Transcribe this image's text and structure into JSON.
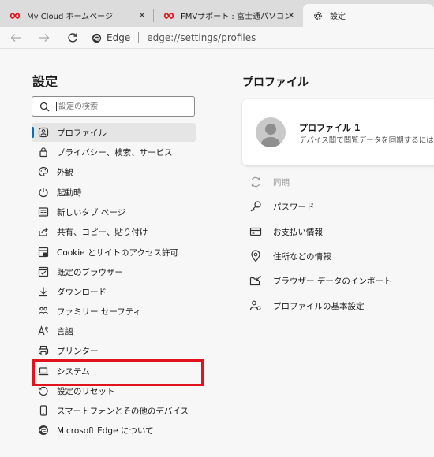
{
  "tabs": [
    {
      "label": "My Cloud ホームページ",
      "icon": "mycloud-logo-icon"
    },
    {
      "label": "FMVサポート : 富士通パソコン",
      "icon": "mycloud-logo-icon"
    },
    {
      "label": "設定",
      "icon": "gear-icon"
    }
  ],
  "address": {
    "site_label": "Edge",
    "url": "edge://settings/profiles"
  },
  "sidebar": {
    "title": "設定",
    "search_placeholder": "設定の検索",
    "items": [
      {
        "label": "プロファイル",
        "icon": "profile-icon",
        "active": true
      },
      {
        "label": "プライバシー、検索、サービス",
        "icon": "lock-icon"
      },
      {
        "label": "外観",
        "icon": "palette-icon"
      },
      {
        "label": "起動時",
        "icon": "power-icon"
      },
      {
        "label": "新しいタブ ページ",
        "icon": "newtab-icon"
      },
      {
        "label": "共有、コピー、貼り付け",
        "icon": "share-icon"
      },
      {
        "label": "Cookie とサイトのアクセス許可",
        "icon": "cookie-icon"
      },
      {
        "label": "既定のブラウザー",
        "icon": "default-browser-icon"
      },
      {
        "label": "ダウンロード",
        "icon": "download-icon"
      },
      {
        "label": "ファミリー セーフティ",
        "icon": "family-icon"
      },
      {
        "label": "言語",
        "icon": "language-icon"
      },
      {
        "label": "プリンター",
        "icon": "printer-icon"
      },
      {
        "label": "システム",
        "icon": "laptop-icon"
      },
      {
        "label": "設定のリセット",
        "icon": "reset-icon"
      },
      {
        "label": "スマートフォンとその他のデバイス",
        "icon": "phone-icon"
      },
      {
        "label": "Microsoft Edge について",
        "icon": "edge-logo-icon"
      }
    ]
  },
  "main": {
    "title": "プロファイル",
    "profile": {
      "name": "プロファイル 1",
      "description": "デバイス間で閲覧データを同期するには、"
    },
    "items": [
      {
        "label": "同期",
        "icon": "sync-icon",
        "disabled": true
      },
      {
        "label": "パスワード",
        "icon": "key-icon"
      },
      {
        "label": "お支払い情報",
        "icon": "card-icon"
      },
      {
        "label": "住所などの情報",
        "icon": "location-icon"
      },
      {
        "label": "ブラウザー データのインポート",
        "icon": "import-icon"
      },
      {
        "label": "プロファイルの基本設定",
        "icon": "people-settings-icon"
      }
    ]
  },
  "colors": {
    "accent": "#0f6cbd",
    "highlight": "#e0141e",
    "mycloud": "#e0141e"
  }
}
